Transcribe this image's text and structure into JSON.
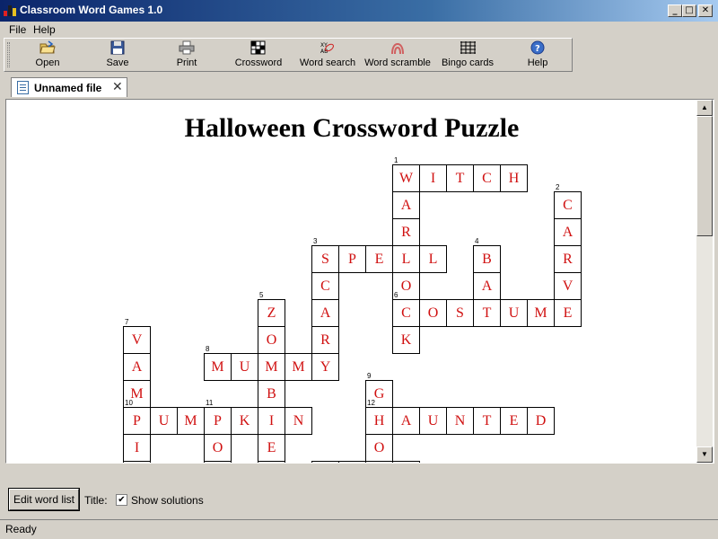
{
  "window": {
    "title": "Classroom Word Games 1.0"
  },
  "menu": [
    "File",
    "Help"
  ],
  "toolbar": [
    {
      "label": "Open",
      "icon": "open-folder-icon"
    },
    {
      "label": "Save",
      "icon": "floppy-disk-icon"
    },
    {
      "label": "Print",
      "icon": "printer-icon"
    },
    {
      "label": "Crossword",
      "icon": "crossword-grid-icon"
    },
    {
      "label": "Word search",
      "icon": "word-search-icon"
    },
    {
      "label": "Word scramble",
      "icon": "word-scramble-icon"
    },
    {
      "label": "Bingo cards",
      "icon": "bingo-grid-icon"
    },
    {
      "label": "Help",
      "icon": "help-icon"
    }
  ],
  "tab": {
    "label": "Unnamed file",
    "close": "✕"
  },
  "document": {
    "title": "Halloween Crossword Puzzle",
    "cells": [
      {
        "c": 14,
        "r": 0,
        "l": "W",
        "n": "1"
      },
      {
        "c": 15,
        "r": 0,
        "l": "I"
      },
      {
        "c": 16,
        "r": 0,
        "l": "T"
      },
      {
        "c": 17,
        "r": 0,
        "l": "C"
      },
      {
        "c": 18,
        "r": 0,
        "l": "H"
      },
      {
        "c": 14,
        "r": 1,
        "l": "A"
      },
      {
        "c": 14,
        "r": 2,
        "l": "R"
      },
      {
        "c": 14,
        "r": 3,
        "l": "L"
      },
      {
        "c": 14,
        "r": 4,
        "l": "O"
      },
      {
        "c": 14,
        "r": 5,
        "l": "C",
        "n": "6"
      },
      {
        "c": 14,
        "r": 6,
        "l": "K"
      },
      {
        "c": 20,
        "r": 1,
        "l": "C",
        "n": "2"
      },
      {
        "c": 20,
        "r": 2,
        "l": "A"
      },
      {
        "c": 20,
        "r": 3,
        "l": "R"
      },
      {
        "c": 20,
        "r": 4,
        "l": "V"
      },
      {
        "c": 20,
        "r": 5,
        "l": "E"
      },
      {
        "c": 11,
        "r": 3,
        "l": "S",
        "n": "3"
      },
      {
        "c": 12,
        "r": 3,
        "l": "P"
      },
      {
        "c": 13,
        "r": 3,
        "l": "E"
      },
      {
        "c": 15,
        "r": 3,
        "l": "L"
      },
      {
        "c": 11,
        "r": 4,
        "l": "C"
      },
      {
        "c": 11,
        "r": 5,
        "l": "A"
      },
      {
        "c": 11,
        "r": 6,
        "l": "R"
      },
      {
        "c": 11,
        "r": 7,
        "l": "Y"
      },
      {
        "c": 17,
        "r": 3,
        "l": "B",
        "n": "4"
      },
      {
        "c": 17,
        "r": 4,
        "l": "A"
      },
      {
        "c": 17,
        "r": 5,
        "l": "T"
      },
      {
        "c": 15,
        "r": 5,
        "l": "O"
      },
      {
        "c": 16,
        "r": 5,
        "l": "S"
      },
      {
        "c": 18,
        "r": 5,
        "l": "U"
      },
      {
        "c": 19,
        "r": 5,
        "l": "M"
      },
      {
        "c": 9,
        "r": 5,
        "l": "Z",
        "n": "5"
      },
      {
        "c": 9,
        "r": 6,
        "l": "O"
      },
      {
        "c": 9,
        "r": 7,
        "l": "M"
      },
      {
        "c": 9,
        "r": 8,
        "l": "B"
      },
      {
        "c": 9,
        "r": 9,
        "l": "I"
      },
      {
        "c": 9,
        "r": 10,
        "l": "E"
      },
      {
        "c": 4,
        "r": 6,
        "l": "V",
        "n": "7"
      },
      {
        "c": 4,
        "r": 7,
        "l": "A"
      },
      {
        "c": 4,
        "r": 8,
        "l": "M"
      },
      {
        "c": 4,
        "r": 9,
        "l": "P",
        "n": "10"
      },
      {
        "c": 4,
        "r": 10,
        "l": "I"
      },
      {
        "c": 7,
        "r": 7,
        "l": "M",
        "n": "8"
      },
      {
        "c": 8,
        "r": 7,
        "l": "U"
      },
      {
        "c": 10,
        "r": 7,
        "l": "M"
      },
      {
        "c": 13,
        "r": 8,
        "l": "G",
        "n": "9"
      },
      {
        "c": 13,
        "r": 9,
        "l": "H",
        "n": "12"
      },
      {
        "c": 13,
        "r": 10,
        "l": "O"
      },
      {
        "c": 5,
        "r": 9,
        "l": "U"
      },
      {
        "c": 6,
        "r": 9,
        "l": "M"
      },
      {
        "c": 7,
        "r": 9,
        "l": "P",
        "n": "11"
      },
      {
        "c": 8,
        "r": 9,
        "l": "K"
      },
      {
        "c": 10,
        "r": 9,
        "l": "N"
      },
      {
        "c": 7,
        "r": 10,
        "l": "O"
      },
      {
        "c": 14,
        "r": 9,
        "l": "A"
      },
      {
        "c": 15,
        "r": 9,
        "l": "U"
      },
      {
        "c": 16,
        "r": 9,
        "l": "N"
      },
      {
        "c": 17,
        "r": 9,
        "l": "T"
      },
      {
        "c": 18,
        "r": 9,
        "l": "E"
      },
      {
        "c": 19,
        "r": 9,
        "l": "D"
      },
      {
        "c": 4,
        "r": 11,
        "l": ""
      },
      {
        "c": 7,
        "r": 11,
        "l": ""
      },
      {
        "c": 9,
        "r": 11,
        "l": ""
      },
      {
        "c": 11,
        "r": 11,
        "l": ""
      },
      {
        "c": 12,
        "r": 11,
        "l": ""
      },
      {
        "c": 13,
        "r": 11,
        "l": ""
      },
      {
        "c": 14,
        "r": 11,
        "l": ""
      }
    ]
  },
  "bottom": {
    "edit_button": "Edit word list",
    "title_label": "Title:",
    "show_solutions": "Show solutions",
    "checked": "✔"
  },
  "status": "Ready"
}
